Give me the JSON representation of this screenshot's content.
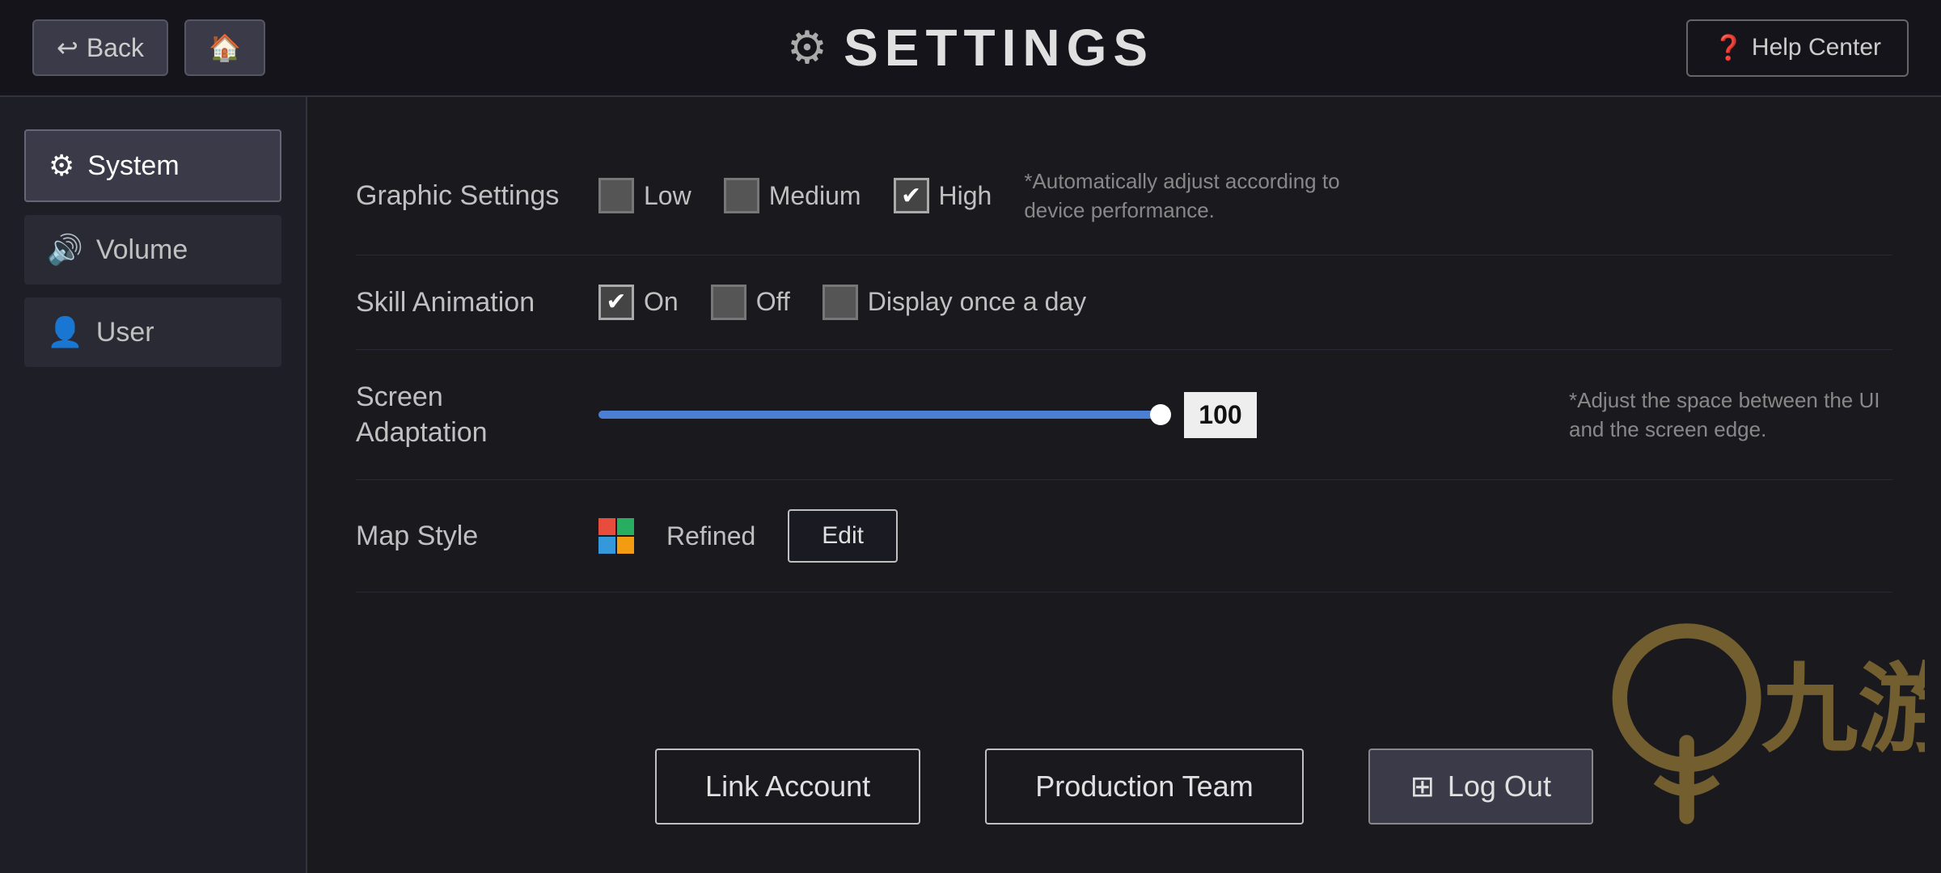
{
  "header": {
    "back_label": "Back",
    "home_icon": "🏠",
    "back_icon": "↩",
    "title": "SETTINGS",
    "title_icon": "⚙",
    "help_label": "Help Center",
    "help_icon": "?"
  },
  "sidebar": {
    "items": [
      {
        "id": "system",
        "label": "System",
        "icon": "⚙",
        "active": true
      },
      {
        "id": "volume",
        "label": "Volume",
        "icon": "🔊",
        "active": false
      },
      {
        "id": "user",
        "label": "User",
        "icon": "👤",
        "active": false
      }
    ]
  },
  "settings": {
    "graphic": {
      "label": "Graphic Settings",
      "options": [
        {
          "id": "low",
          "label": "Low",
          "checked": false
        },
        {
          "id": "medium",
          "label": "Medium",
          "checked": false
        },
        {
          "id": "high",
          "label": "High",
          "checked": true
        }
      ],
      "note": "*Automatically adjust according to device performance."
    },
    "skill_animation": {
      "label": "Skill Animation",
      "options": [
        {
          "id": "on",
          "label": "On",
          "checked": true
        },
        {
          "id": "off",
          "label": "Off",
          "checked": false
        },
        {
          "id": "display_once",
          "label": "Display once a day",
          "checked": false
        }
      ]
    },
    "screen_adaptation": {
      "label": "Screen Adaptation",
      "value": "100",
      "note": "*Adjust the space between the UI and the screen edge."
    },
    "map_style": {
      "label": "Map Style",
      "value": "Refined",
      "edit_label": "Edit"
    }
  },
  "actions": {
    "link_account": "Link Account",
    "production_team": "Production Team",
    "log_out": "Log Out",
    "logout_icon": "⬛"
  },
  "watermark": {
    "text": "九游"
  }
}
